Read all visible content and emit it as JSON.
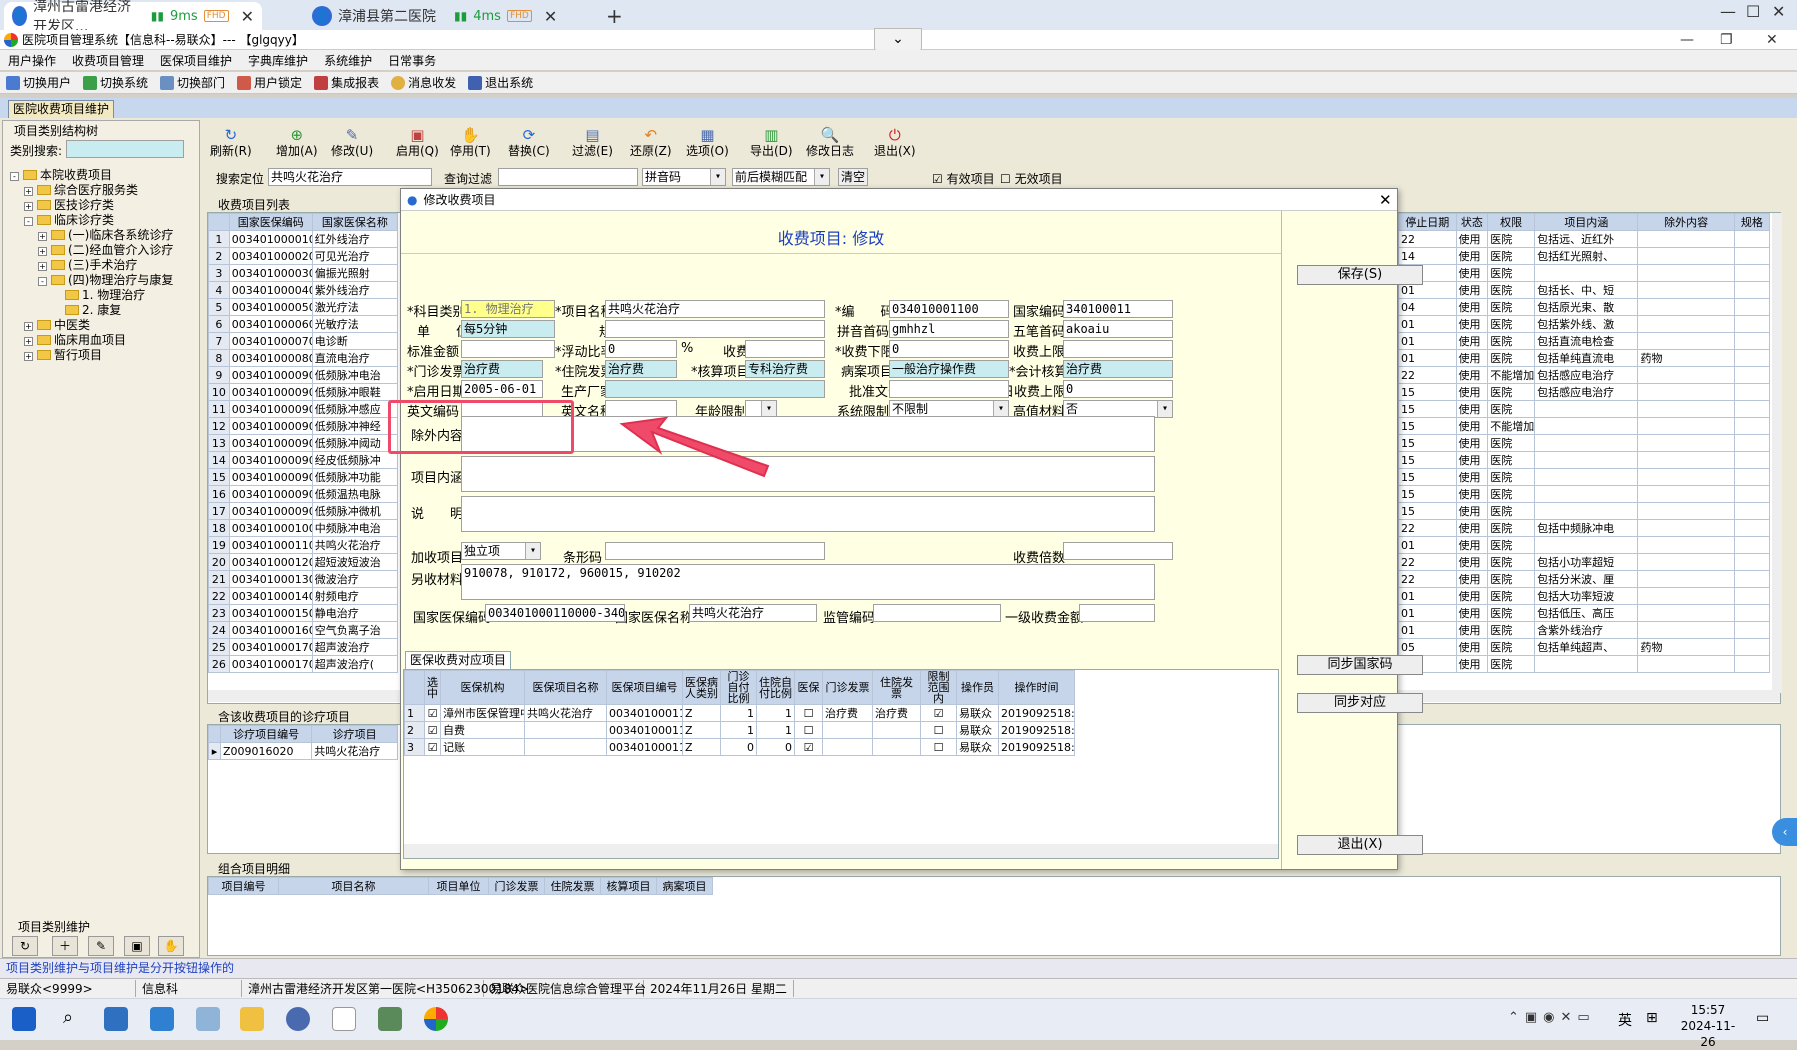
{
  "browser": {
    "tabs": [
      {
        "title": "漳州古雷港经济开发区...",
        "latency": "9ms",
        "badge": "FHD"
      },
      {
        "title": "漳浦县第二医院",
        "latency": "4ms",
        "badge": "FHD"
      }
    ]
  },
  "app": {
    "title": "医院项目管理系统【信息科--易联众】--- 【glgqyy】"
  },
  "menu": [
    "用户操作",
    "收费项目管理",
    "医保项目维护",
    "字典库维护",
    "系统维护",
    "日常事务"
  ],
  "toolbar": [
    "切换用户",
    "切换系统",
    "切换部门",
    "用户锁定",
    "集成报表",
    "消息收发",
    "退出系统"
  ],
  "outer_tab": "医院收费项目维护",
  "left": {
    "group_title": "项目类别结构树",
    "search_label": "类别搜索:",
    "tree": [
      {
        "label": "本院收费项目",
        "lvl": 0,
        "exp": "-"
      },
      {
        "label": "综合医疗服务类",
        "lvl": 1,
        "exp": "+"
      },
      {
        "label": "医技诊疗类",
        "lvl": 1,
        "exp": "+"
      },
      {
        "label": "临床诊疗类",
        "lvl": 1,
        "exp": "-"
      },
      {
        "label": "(一)临床各系统诊疗",
        "lvl": 2,
        "exp": "+"
      },
      {
        "label": "(二)经血管介入诊疗",
        "lvl": 2,
        "exp": "+"
      },
      {
        "label": "(三)手术治疗",
        "lvl": 2,
        "exp": "+"
      },
      {
        "label": "(四)物理治疗与康复",
        "lvl": 2,
        "exp": "-"
      },
      {
        "label": "1. 物理治疗",
        "lvl": 3,
        "exp": ""
      },
      {
        "label": "2. 康复",
        "lvl": 3,
        "exp": ""
      },
      {
        "label": "中医类",
        "lvl": 1,
        "exp": "+"
      },
      {
        "label": "临床用血项目",
        "lvl": 1,
        "exp": "+"
      },
      {
        "label": "暂行项目",
        "lvl": 1,
        "exp": "+"
      }
    ],
    "bottom_title": "项目类别维护"
  },
  "actions": [
    "刷新(R)",
    "增加(A)",
    "修改(U)",
    "启用(Q)",
    "停用(T)",
    "替换(C)",
    "过滤(E)",
    "还原(Z)",
    "选项(O)",
    "导出(D)",
    "修改日志",
    "退出(X)"
  ],
  "search": {
    "locate_label": "搜索定位",
    "locate_value": "共鸣火花治疗",
    "filter_label": "查询过滤",
    "mode": "拼音码",
    "match": "前后模糊匹配",
    "clear": "清空",
    "valid": "有效项目",
    "invalid": "无效项目"
  },
  "list": {
    "title": "收费项目列表",
    "headers": [
      "国家医保编码",
      "国家医保名称"
    ],
    "rows": [
      [
        "003401000010",
        "红外线治疗"
      ],
      [
        "003401000020",
        "可见光治疗"
      ],
      [
        "003401000030",
        "偏振光照射"
      ],
      [
        "003401000040",
        "紫外线治疗"
      ],
      [
        "003401000050",
        "激光疗法"
      ],
      [
        "003401000060",
        "光敏疗法"
      ],
      [
        "003401000070",
        "电诊断"
      ],
      [
        "003401000080",
        "直流电治疗"
      ],
      [
        "003401000090",
        "低频脉冲电治"
      ],
      [
        "003401000090",
        "低频脉冲眼鞋"
      ],
      [
        "003401000090",
        "低频脉冲感应"
      ],
      [
        "003401000090",
        "低频脉冲神经"
      ],
      [
        "003401000090",
        "低频脉冲阈动"
      ],
      [
        "003401000090",
        "经皮低频脉冲"
      ],
      [
        "003401000090",
        "低频脉冲功能"
      ],
      [
        "003401000090",
        "低频温热电脉"
      ],
      [
        "003401000090",
        "低频脉冲微机"
      ],
      [
        "003401000100",
        "中频脉冲电治"
      ],
      [
        "003401000110",
        "共鸣火花治疗"
      ],
      [
        "003401000120",
        "超短波短波治"
      ],
      [
        "003401000130",
        "微波治疗"
      ],
      [
        "003401000140",
        "射频电疗"
      ],
      [
        "003401000150",
        "静电治疗"
      ],
      [
        "003401000160",
        "空气负离子治"
      ],
      [
        "003401000170",
        "超声波治疗"
      ],
      [
        "003401000170",
        "超声波治疗("
      ]
    ],
    "right_headers": [
      "停止日期",
      "状态",
      "权限",
      "项目内涵",
      "除外内容",
      "规格"
    ],
    "right_rows": [
      [
        "22",
        "使用",
        "医院",
        "包括远、近红外",
        "",
        ""
      ],
      [
        "14",
        "使用",
        "医院",
        "包括红光照射、",
        "",
        ""
      ],
      [
        "15",
        "使用",
        "医院",
        "",
        "",
        ""
      ],
      [
        "01",
        "使用",
        "医院",
        "包括长、中、短",
        "",
        ""
      ],
      [
        "04",
        "使用",
        "医院",
        "包括原光束、散",
        "",
        ""
      ],
      [
        "01",
        "使用",
        "医院",
        "包括紫外线、激",
        "",
        ""
      ],
      [
        "01",
        "使用",
        "医院",
        "包括直流电检查",
        "",
        ""
      ],
      [
        "01",
        "使用",
        "医院",
        "包括单纯直流电",
        "药物",
        ""
      ],
      [
        "22",
        "使用",
        "不能增加",
        "包括感应电治疗",
        "",
        ""
      ],
      [
        "15",
        "使用",
        "医院",
        "包括感应电治疗",
        "",
        ""
      ],
      [
        "15",
        "使用",
        "医院",
        "",
        "",
        ""
      ],
      [
        "15",
        "使用",
        "不能增加",
        "",
        "",
        ""
      ],
      [
        "15",
        "使用",
        "医院",
        "",
        "",
        ""
      ],
      [
        "15",
        "使用",
        "医院",
        "",
        "",
        ""
      ],
      [
        "15",
        "使用",
        "医院",
        "",
        "",
        ""
      ],
      [
        "15",
        "使用",
        "医院",
        "",
        "",
        ""
      ],
      [
        "15",
        "使用",
        "医院",
        "",
        "",
        ""
      ],
      [
        "22",
        "使用",
        "医院",
        "包括中频脉冲电",
        "",
        ""
      ],
      [
        "01",
        "使用",
        "医院",
        "",
        "",
        ""
      ],
      [
        "22",
        "使用",
        "医院",
        "包括小功率超短",
        "",
        ""
      ],
      [
        "22",
        "使用",
        "医院",
        "包括分米波、厘",
        "",
        ""
      ],
      [
        "01",
        "使用",
        "医院",
        "包括大功率短波",
        "",
        ""
      ],
      [
        "01",
        "使用",
        "医院",
        "包括低压、高压",
        "",
        ""
      ],
      [
        "01",
        "使用",
        "医院",
        "含紫外线治疗",
        "",
        ""
      ],
      [
        "05",
        "使用",
        "医院",
        "包括单纯超声、",
        "药物",
        ""
      ],
      [
        "07",
        "使用",
        "医院",
        "",
        "",
        ""
      ]
    ]
  },
  "diag": {
    "title": "含该收费项目的诊疗项目",
    "headers": [
      "诊疗项目编号",
      "诊疗项目"
    ],
    "rows": [
      [
        "Z009016020",
        "共鸣火花治疗"
      ]
    ]
  },
  "combo": {
    "title": "组合项目明细",
    "headers": [
      "项目编号",
      "项目名称",
      "项目单位",
      "门诊发票",
      "住院发票",
      "核算项目",
      "病案项目"
    ]
  },
  "dialog": {
    "title": "修改收费项目",
    "heading": "收费项目: 修改",
    "labels": {
      "category": "*科目类别",
      "name": "*项目名称",
      "code": "*编　　码",
      "natcode": "国家编码",
      "unit": "单　　位",
      "spec": "规格",
      "pinyin": "拼音首码",
      "wubi": "五笔首码",
      "stdamt": "标准金额",
      "float": "*浮动比率",
      "pct": "%",
      "feeamt": "收费金额",
      "feemin": "*收费下限",
      "feemax": "收费上限",
      "opinv": "*门诊发票",
      "ipinv": "*住院发票",
      "acct": "*核算项目",
      "medrec": "病案项目",
      "ledger": "*会计核算",
      "startdate": "*启用日期",
      "maker": "生产厂家",
      "approval": "批准文号",
      "daymax": "日收费上限",
      "enc": "英文编码",
      "enn": "英文名称",
      "age": "年龄限制",
      "sys": "系统限制",
      "hv": "高值材料",
      "excl": "除外内容",
      "content": "项目内涵",
      "desc": "说　　明",
      "addon": "加收项目",
      "barcode": "条形码",
      "mult": "收费倍数",
      "extra": "另收材料",
      "natmedcode": "国家医保编码",
      "natmedname": "国家医保名称",
      "supcode": "监管编码",
      "lv1": "一级收费金额"
    },
    "values": {
      "category": "1. 物理治疗",
      "name": "共鸣火花治疗",
      "code": "034010001100",
      "natcode": "340100011",
      "unit": "每5分钟",
      "spec": "",
      "pinyin": "gmhhzl",
      "wubi": "akoaiu",
      "stdamt": "",
      "float": "0",
      "feeamt": "",
      "feemin": "0",
      "feemax": "",
      "opinv": "治疗费",
      "ipinv": "治疗费",
      "acct": "专科治疗费",
      "medrec": "一般治疗操作费",
      "ledger": "治疗费",
      "startdate": "2005-06-01",
      "maker": "",
      "approval": "",
      "daymax": "0",
      "enc": "",
      "enn": "",
      "age": "",
      "sys": "不限制",
      "hv": "否",
      "excl": "",
      "content": "",
      "desc": "",
      "addon": "独立项",
      "barcode": "",
      "mult": "",
      "extra": "910078, 910172, 960015, 910202",
      "natmedcode": "003401000110000-340100",
      "natmedname": "共鸣火花治疗",
      "supcode": "",
      "lv1": ""
    },
    "buttons": {
      "save": "保存(S)",
      "sync_nat": "同步国家码",
      "sync_match": "同步对应",
      "exit": "退出(X)"
    },
    "subtab": "医保收费对应项目",
    "sub_headers": [
      "选中",
      "医保机构",
      "医保项目名称",
      "医保项目编号",
      "医保病人类别",
      "门诊自付比例",
      "住院自付比例",
      "医保",
      "门诊发票",
      "住院发票",
      "限制范围内",
      "操作员",
      "操作时间"
    ],
    "sub_rows": [
      [
        "1",
        "☑",
        "漳州市医保管理中心",
        "共鸣火花治疗",
        "003401000110000",
        "Z",
        "1",
        "1",
        "☐",
        "治疗费",
        "治疗费",
        "☑",
        "易联众",
        "2019092518:15:34"
      ],
      [
        "2",
        "☑",
        "自费",
        "",
        "003401000110000",
        "Z",
        "1",
        "1",
        "☐",
        "",
        "",
        "☐",
        "易联众",
        "2019092518:15:34"
      ],
      [
        "3",
        "☑",
        "记账",
        "",
        "003401000110000",
        "Z",
        "0",
        "0",
        "☑",
        "",
        "",
        "☐",
        "易联众",
        "2019092518:15:34"
      ]
    ]
  },
  "status": [
    "易联众<9999>",
    "信息科",
    "漳州古雷港经济开发区第一医院<H35062300184>",
    "易联众医院信息综合管理平台",
    "2024年11月26日 星期二"
  ],
  "status_hint": "项目类别维护与项目维护是分开按钮操作的",
  "clock": {
    "time": "15:57",
    "date": "2024-11-26"
  },
  "tray": "英"
}
